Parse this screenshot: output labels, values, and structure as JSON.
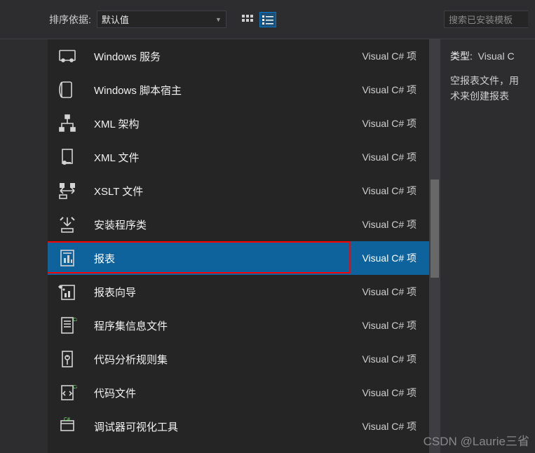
{
  "toolbar": {
    "sort_label": "排序依据:",
    "sort_value": "默认值",
    "search_placeholder": "搜索已安装模板"
  },
  "right": {
    "type_label": "类型:",
    "type_value": "Visual C",
    "desc_line1": "空报表文件，用",
    "desc_line2": "术来创建报表"
  },
  "watermark": "CSDN @Laurie三省",
  "items": [
    {
      "name": "Windows 服务",
      "lang": "Visual C# 项",
      "icon": "winservice",
      "selected": false,
      "highlight": false
    },
    {
      "name": "Windows 脚本宿主",
      "lang": "Visual C# 项",
      "icon": "script-host",
      "selected": false,
      "highlight": false
    },
    {
      "name": "XML 架构",
      "lang": "Visual C# 项",
      "icon": "xml-schema",
      "selected": false,
      "highlight": false
    },
    {
      "name": "XML 文件",
      "lang": "Visual C# 项",
      "icon": "xml-file",
      "selected": false,
      "highlight": false
    },
    {
      "name": "XSLT 文件",
      "lang": "Visual C# 项",
      "icon": "xslt-file",
      "selected": false,
      "highlight": false
    },
    {
      "name": "安装程序类",
      "lang": "Visual C# 项",
      "icon": "installer",
      "selected": false,
      "highlight": false
    },
    {
      "name": "报表",
      "lang": "Visual C# 项",
      "icon": "report",
      "selected": true,
      "highlight": true
    },
    {
      "name": "报表向导",
      "lang": "Visual C# 项",
      "icon": "report-wizard",
      "selected": false,
      "highlight": false
    },
    {
      "name": "程序集信息文件",
      "lang": "Visual C# 项",
      "icon": "assembly-info",
      "selected": false,
      "highlight": false
    },
    {
      "name": "代码分析规则集",
      "lang": "Visual C# 项",
      "icon": "ruleset",
      "selected": false,
      "highlight": false
    },
    {
      "name": "代码文件",
      "lang": "Visual C# 项",
      "icon": "code-file",
      "selected": false,
      "highlight": false
    },
    {
      "name": "调试器可视化工具",
      "lang": "Visual C# 项",
      "icon": "visualizer",
      "selected": false,
      "highlight": false
    }
  ]
}
